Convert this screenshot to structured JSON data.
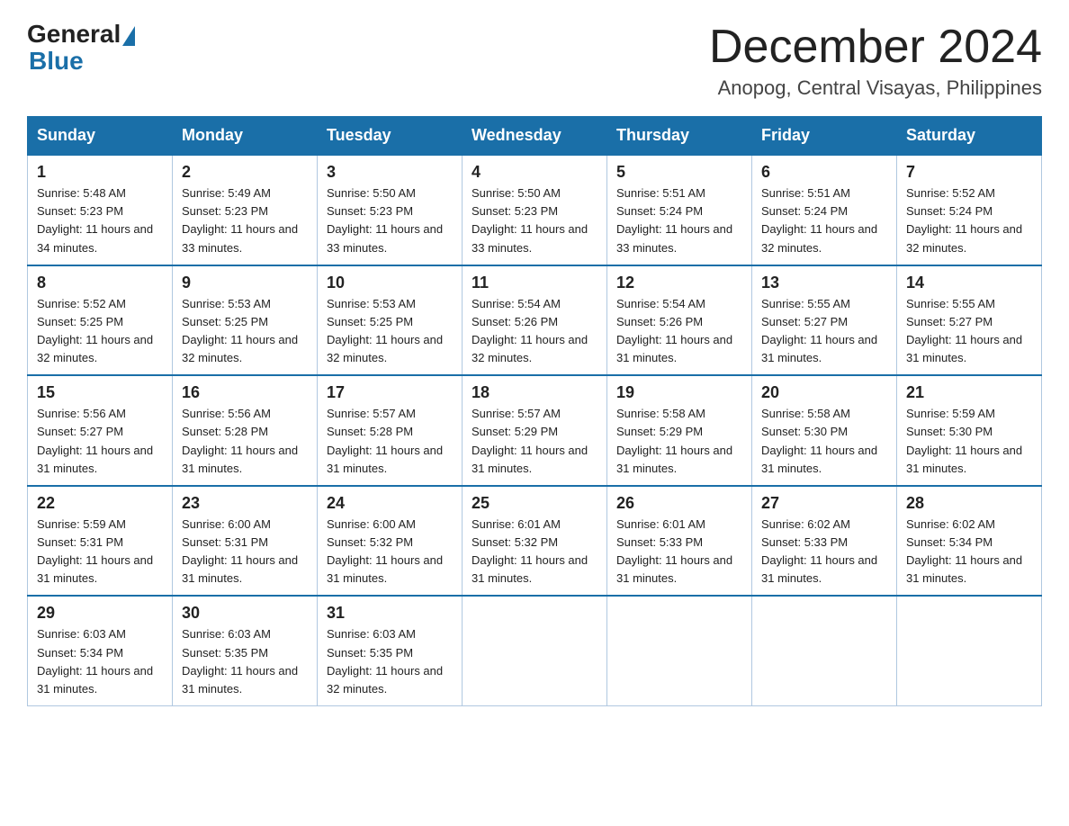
{
  "header": {
    "logo_general": "General",
    "logo_blue": "Blue",
    "month_year": "December 2024",
    "location": "Anopog, Central Visayas, Philippines"
  },
  "days_of_week": [
    "Sunday",
    "Monday",
    "Tuesday",
    "Wednesday",
    "Thursday",
    "Friday",
    "Saturday"
  ],
  "weeks": [
    [
      {
        "day": "1",
        "sunrise": "5:48 AM",
        "sunset": "5:23 PM",
        "daylight": "11 hours and 34 minutes."
      },
      {
        "day": "2",
        "sunrise": "5:49 AM",
        "sunset": "5:23 PM",
        "daylight": "11 hours and 33 minutes."
      },
      {
        "day": "3",
        "sunrise": "5:50 AM",
        "sunset": "5:23 PM",
        "daylight": "11 hours and 33 minutes."
      },
      {
        "day": "4",
        "sunrise": "5:50 AM",
        "sunset": "5:23 PM",
        "daylight": "11 hours and 33 minutes."
      },
      {
        "day": "5",
        "sunrise": "5:51 AM",
        "sunset": "5:24 PM",
        "daylight": "11 hours and 33 minutes."
      },
      {
        "day": "6",
        "sunrise": "5:51 AM",
        "sunset": "5:24 PM",
        "daylight": "11 hours and 32 minutes."
      },
      {
        "day": "7",
        "sunrise": "5:52 AM",
        "sunset": "5:24 PM",
        "daylight": "11 hours and 32 minutes."
      }
    ],
    [
      {
        "day": "8",
        "sunrise": "5:52 AM",
        "sunset": "5:25 PM",
        "daylight": "11 hours and 32 minutes."
      },
      {
        "day": "9",
        "sunrise": "5:53 AM",
        "sunset": "5:25 PM",
        "daylight": "11 hours and 32 minutes."
      },
      {
        "day": "10",
        "sunrise": "5:53 AM",
        "sunset": "5:25 PM",
        "daylight": "11 hours and 32 minutes."
      },
      {
        "day": "11",
        "sunrise": "5:54 AM",
        "sunset": "5:26 PM",
        "daylight": "11 hours and 32 minutes."
      },
      {
        "day": "12",
        "sunrise": "5:54 AM",
        "sunset": "5:26 PM",
        "daylight": "11 hours and 31 minutes."
      },
      {
        "day": "13",
        "sunrise": "5:55 AM",
        "sunset": "5:27 PM",
        "daylight": "11 hours and 31 minutes."
      },
      {
        "day": "14",
        "sunrise": "5:55 AM",
        "sunset": "5:27 PM",
        "daylight": "11 hours and 31 minutes."
      }
    ],
    [
      {
        "day": "15",
        "sunrise": "5:56 AM",
        "sunset": "5:27 PM",
        "daylight": "11 hours and 31 minutes."
      },
      {
        "day": "16",
        "sunrise": "5:56 AM",
        "sunset": "5:28 PM",
        "daylight": "11 hours and 31 minutes."
      },
      {
        "day": "17",
        "sunrise": "5:57 AM",
        "sunset": "5:28 PM",
        "daylight": "11 hours and 31 minutes."
      },
      {
        "day": "18",
        "sunrise": "5:57 AM",
        "sunset": "5:29 PM",
        "daylight": "11 hours and 31 minutes."
      },
      {
        "day": "19",
        "sunrise": "5:58 AM",
        "sunset": "5:29 PM",
        "daylight": "11 hours and 31 minutes."
      },
      {
        "day": "20",
        "sunrise": "5:58 AM",
        "sunset": "5:30 PM",
        "daylight": "11 hours and 31 minutes."
      },
      {
        "day": "21",
        "sunrise": "5:59 AM",
        "sunset": "5:30 PM",
        "daylight": "11 hours and 31 minutes."
      }
    ],
    [
      {
        "day": "22",
        "sunrise": "5:59 AM",
        "sunset": "5:31 PM",
        "daylight": "11 hours and 31 minutes."
      },
      {
        "day": "23",
        "sunrise": "6:00 AM",
        "sunset": "5:31 PM",
        "daylight": "11 hours and 31 minutes."
      },
      {
        "day": "24",
        "sunrise": "6:00 AM",
        "sunset": "5:32 PM",
        "daylight": "11 hours and 31 minutes."
      },
      {
        "day": "25",
        "sunrise": "6:01 AM",
        "sunset": "5:32 PM",
        "daylight": "11 hours and 31 minutes."
      },
      {
        "day": "26",
        "sunrise": "6:01 AM",
        "sunset": "5:33 PM",
        "daylight": "11 hours and 31 minutes."
      },
      {
        "day": "27",
        "sunrise": "6:02 AM",
        "sunset": "5:33 PM",
        "daylight": "11 hours and 31 minutes."
      },
      {
        "day": "28",
        "sunrise": "6:02 AM",
        "sunset": "5:34 PM",
        "daylight": "11 hours and 31 minutes."
      }
    ],
    [
      {
        "day": "29",
        "sunrise": "6:03 AM",
        "sunset": "5:34 PM",
        "daylight": "11 hours and 31 minutes."
      },
      {
        "day": "30",
        "sunrise": "6:03 AM",
        "sunset": "5:35 PM",
        "daylight": "11 hours and 31 minutes."
      },
      {
        "day": "31",
        "sunrise": "6:03 AM",
        "sunset": "5:35 PM",
        "daylight": "11 hours and 32 minutes."
      },
      null,
      null,
      null,
      null
    ]
  ]
}
